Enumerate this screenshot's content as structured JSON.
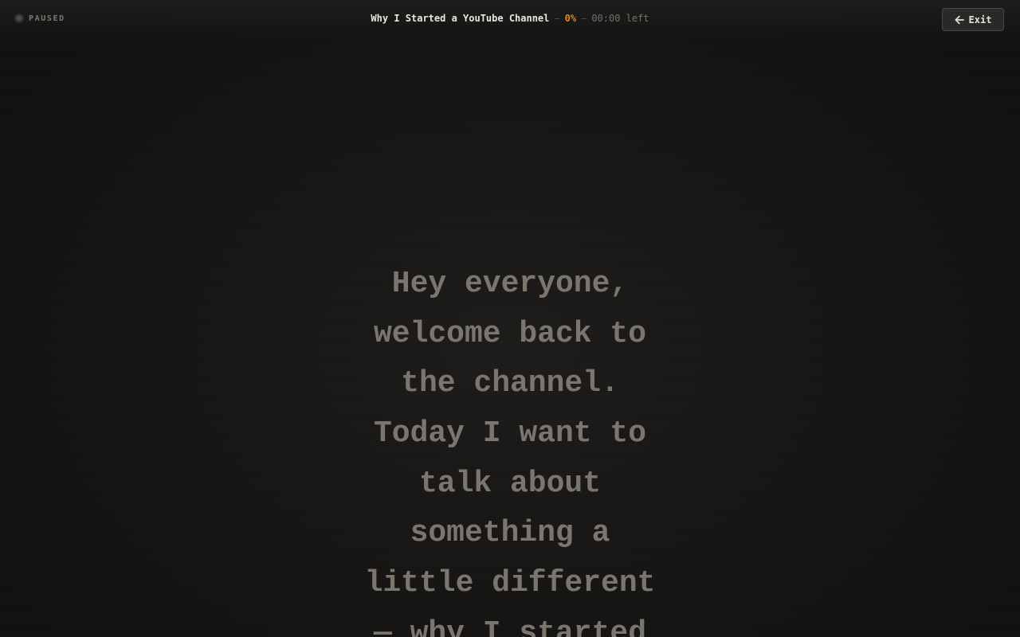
{
  "status": {
    "label": "PAUSED"
  },
  "header": {
    "title": "Why I Started a YouTube Channel",
    "separator_1": "—",
    "progress_percent": "0%",
    "separator_2": "—",
    "time_left": "00:00 left"
  },
  "exit_button": {
    "label": "Exit",
    "icon": "arrow-left-icon"
  },
  "script": {
    "lines": [
      "Hey everyone,",
      "welcome back to",
      "the channel.",
      "Today I want to",
      "talk about",
      "something a",
      "little different",
      "— why I started"
    ]
  },
  "colors": {
    "accent": "#d8892e",
    "title_text": "#e9e6e0",
    "script_text": "#7a756d",
    "background": "#141413"
  }
}
